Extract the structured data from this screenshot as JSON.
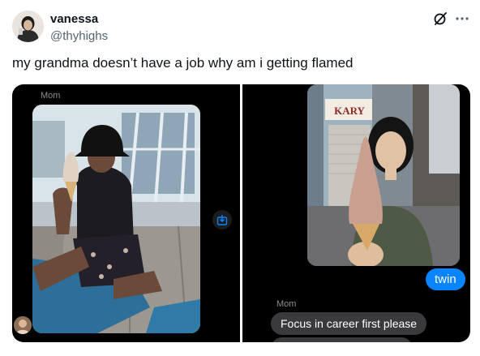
{
  "tweet": {
    "display_name": "vanessa",
    "handle": "@thyhighs",
    "text": "my grandma doesn’t have a job why am i getting flamed"
  },
  "icons": {
    "avatar": "profile-photo",
    "grok": "grok-icon",
    "more": "more-icon",
    "save": "save-download-icon"
  },
  "media": {
    "left_panel": {
      "sender_label": "Mom"
    },
    "right_panel": {
      "sign_text": "KARY",
      "reply_bubble": "twin",
      "sender_label": "Mom",
      "mom_message": "Focus in career first please"
    }
  },
  "colors": {
    "imessage_blue": "#0a84ff",
    "received_bubble": "#3a3a3c",
    "chat_background": "#000000",
    "handle_grey": "#536471"
  }
}
